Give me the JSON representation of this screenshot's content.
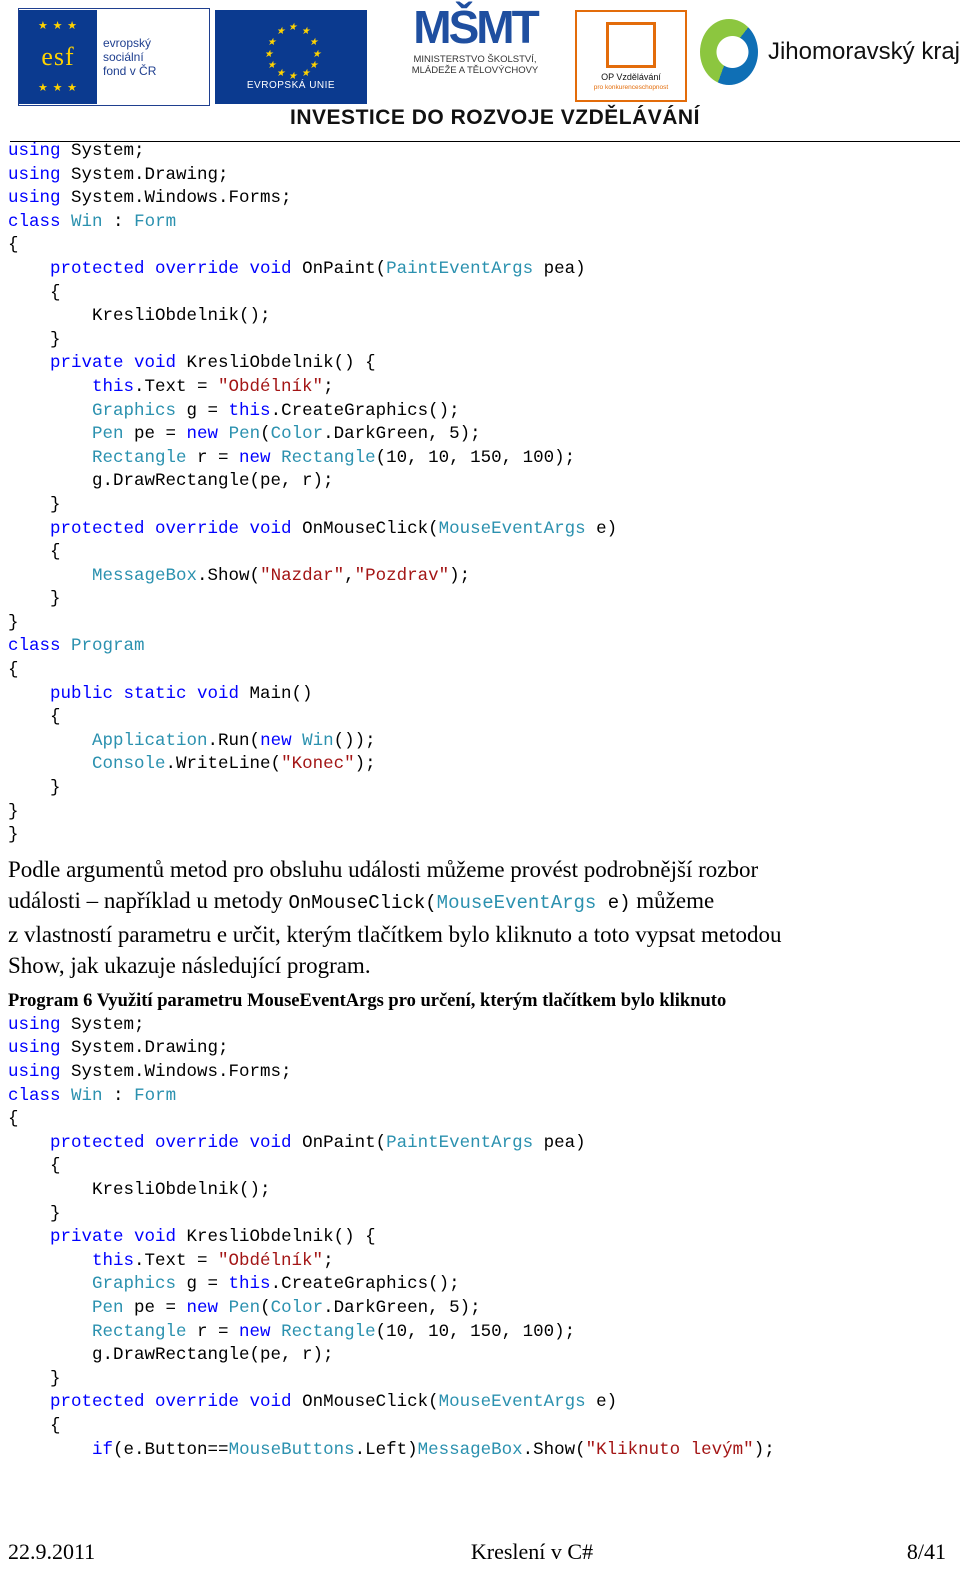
{
  "header": {
    "esf": {
      "line1": "evropský",
      "line2": "sociální",
      "line3": "fond v ČR",
      "brand": "esf",
      "stars": "★ ★ ★"
    },
    "eu": {
      "label": "EVROPSKÁ UNIE",
      "stars": "★"
    },
    "msmt": {
      "mark": "MŠMT",
      "sub_line1": "MINISTERSTVO ŠKOLSTVÍ,",
      "sub_line2": "MLÁDEŽE A TĚLOVÝCHOVY"
    },
    "opvk": {
      "line1": "OP Vzdělávání",
      "line2": "pro konkurenceschopnost"
    },
    "jmk": {
      "label": "Jihomoravský kraj"
    },
    "banner": "INVESTICE DO ROZVOJE VZDĚLÁVÁNÍ"
  },
  "code_block_1": [
    [
      {
        "t": "using",
        "c": "kw"
      },
      {
        "t": " System;",
        "c": "plain"
      }
    ],
    [
      {
        "t": "using",
        "c": "kw"
      },
      {
        "t": " System.Drawing;",
        "c": "plain"
      }
    ],
    [
      {
        "t": "using",
        "c": "kw"
      },
      {
        "t": " System.Windows.Forms;",
        "c": "plain"
      }
    ],
    [
      {
        "t": "class",
        "c": "kw"
      },
      {
        "t": " ",
        "c": "plain"
      },
      {
        "t": "Win",
        "c": "type"
      },
      {
        "t": " : ",
        "c": "plain"
      },
      {
        "t": "Form",
        "c": "type"
      }
    ],
    [
      {
        "t": "{",
        "c": "plain"
      }
    ],
    [
      {
        "t": "    ",
        "c": "plain"
      },
      {
        "t": "protected override void",
        "c": "kw"
      },
      {
        "t": " OnPaint(",
        "c": "plain"
      },
      {
        "t": "PaintEventArgs",
        "c": "type"
      },
      {
        "t": " pea)",
        "c": "plain"
      }
    ],
    [
      {
        "t": "    {",
        "c": "plain"
      }
    ],
    [
      {
        "t": "        KresliObdelnik();",
        "c": "plain"
      }
    ],
    [
      {
        "t": "    }",
        "c": "plain"
      }
    ],
    [
      {
        "t": "    ",
        "c": "plain"
      },
      {
        "t": "private void",
        "c": "kw"
      },
      {
        "t": " KresliObdelnik() {",
        "c": "plain"
      }
    ],
    [
      {
        "t": "        ",
        "c": "plain"
      },
      {
        "t": "this",
        "c": "kw"
      },
      {
        "t": ".Text = ",
        "c": "plain"
      },
      {
        "t": "\"Obdélník\"",
        "c": "str"
      },
      {
        "t": ";",
        "c": "plain"
      }
    ],
    [
      {
        "t": "        ",
        "c": "plain"
      },
      {
        "t": "Graphics",
        "c": "type"
      },
      {
        "t": " g = ",
        "c": "plain"
      },
      {
        "t": "this",
        "c": "kw"
      },
      {
        "t": ".CreateGraphics();",
        "c": "plain"
      }
    ],
    [
      {
        "t": "        ",
        "c": "plain"
      },
      {
        "t": "Pen",
        "c": "type"
      },
      {
        "t": " pe = ",
        "c": "plain"
      },
      {
        "t": "new",
        "c": "kw"
      },
      {
        "t": " ",
        "c": "plain"
      },
      {
        "t": "Pen",
        "c": "type"
      },
      {
        "t": "(",
        "c": "plain"
      },
      {
        "t": "Color",
        "c": "type"
      },
      {
        "t": ".DarkGreen, 5);",
        "c": "plain"
      }
    ],
    [
      {
        "t": "        ",
        "c": "plain"
      },
      {
        "t": "Rectangle",
        "c": "type"
      },
      {
        "t": " r = ",
        "c": "plain"
      },
      {
        "t": "new",
        "c": "kw"
      },
      {
        "t": " ",
        "c": "plain"
      },
      {
        "t": "Rectangle",
        "c": "type"
      },
      {
        "t": "(10, 10, 150, 100);",
        "c": "plain"
      }
    ],
    [
      {
        "t": "        g.DrawRectangle(pe, r);",
        "c": "plain"
      }
    ],
    [
      {
        "t": "    }",
        "c": "plain"
      }
    ],
    [
      {
        "t": "    ",
        "c": "plain"
      },
      {
        "t": "protected override void",
        "c": "kw"
      },
      {
        "t": " OnMouseClick(",
        "c": "plain"
      },
      {
        "t": "MouseEventArgs",
        "c": "type"
      },
      {
        "t": " e)",
        "c": "plain"
      }
    ],
    [
      {
        "t": "    {",
        "c": "plain"
      }
    ],
    [
      {
        "t": "        ",
        "c": "plain"
      },
      {
        "t": "MessageBox",
        "c": "type"
      },
      {
        "t": ".Show(",
        "c": "plain"
      },
      {
        "t": "\"Nazdar\"",
        "c": "str"
      },
      {
        "t": ",",
        "c": "plain"
      },
      {
        "t": "\"Pozdrav\"",
        "c": "str"
      },
      {
        "t": ");",
        "c": "plain"
      }
    ],
    [
      {
        "t": "    }",
        "c": "plain"
      }
    ],
    [
      {
        "t": "}",
        "c": "plain"
      }
    ],
    [
      {
        "t": "class",
        "c": "kw"
      },
      {
        "t": " ",
        "c": "plain"
      },
      {
        "t": "Program",
        "c": "type"
      }
    ],
    [
      {
        "t": "{",
        "c": "plain"
      }
    ],
    [
      {
        "t": "    ",
        "c": "plain"
      },
      {
        "t": "public static void",
        "c": "kw"
      },
      {
        "t": " Main()",
        "c": "plain"
      }
    ],
    [
      {
        "t": "    {",
        "c": "plain"
      }
    ],
    [
      {
        "t": "        ",
        "c": "plain"
      },
      {
        "t": "Application",
        "c": "type"
      },
      {
        "t": ".Run(",
        "c": "plain"
      },
      {
        "t": "new",
        "c": "kw"
      },
      {
        "t": " ",
        "c": "plain"
      },
      {
        "t": "Win",
        "c": "type"
      },
      {
        "t": "());",
        "c": "plain"
      }
    ],
    [
      {
        "t": "        ",
        "c": "plain"
      },
      {
        "t": "Console",
        "c": "type"
      },
      {
        "t": ".WriteLine(",
        "c": "plain"
      },
      {
        "t": "\"Konec\"",
        "c": "str"
      },
      {
        "t": ");",
        "c": "plain"
      }
    ],
    [
      {
        "t": "    }",
        "c": "plain"
      }
    ],
    [
      {
        "t": "}",
        "c": "plain"
      }
    ],
    [
      {
        "t": "}",
        "c": "plain"
      }
    ]
  ],
  "paragraph": {
    "line1_a": "Podle argumentů metod pro obsluhu události můžeme provést podrobnější rozbor",
    "line2_a": "události – například u metody ",
    "line2_mono_1": "OnMouseClick(",
    "line2_mono_type": "MouseEventArgs",
    "line2_mono_2": " e)",
    "line2_b": " můžeme",
    "line3": "z vlastností parametru e určit, kterým tlačítkem bylo kliknuto a toto vypsat metodou",
    "line4": "Show, jak ukazuje následující program."
  },
  "program_title": "Program  6 Využití parametru MouseEventArgs pro určení, kterým tlačítkem bylo kliknuto",
  "code_block_2": [
    [
      {
        "t": "using",
        "c": "kw"
      },
      {
        "t": " System;",
        "c": "plain"
      }
    ],
    [
      {
        "t": "using",
        "c": "kw"
      },
      {
        "t": " System.Drawing;",
        "c": "plain"
      }
    ],
    [
      {
        "t": "using",
        "c": "kw"
      },
      {
        "t": " System.Windows.Forms;",
        "c": "plain"
      }
    ],
    [
      {
        "t": "class",
        "c": "kw"
      },
      {
        "t": " ",
        "c": "plain"
      },
      {
        "t": "Win",
        "c": "type"
      },
      {
        "t": " : ",
        "c": "plain"
      },
      {
        "t": "Form",
        "c": "type"
      }
    ],
    [
      {
        "t": "{",
        "c": "plain"
      }
    ],
    [
      {
        "t": "    ",
        "c": "plain"
      },
      {
        "t": "protected override void",
        "c": "kw"
      },
      {
        "t": " OnPaint(",
        "c": "plain"
      },
      {
        "t": "PaintEventArgs",
        "c": "type"
      },
      {
        "t": " pea)",
        "c": "plain"
      }
    ],
    [
      {
        "t": "    {",
        "c": "plain"
      }
    ],
    [
      {
        "t": "        KresliObdelnik();",
        "c": "plain"
      }
    ],
    [
      {
        "t": "    }",
        "c": "plain"
      }
    ],
    [
      {
        "t": "    ",
        "c": "plain"
      },
      {
        "t": "private void",
        "c": "kw"
      },
      {
        "t": " KresliObdelnik() {",
        "c": "plain"
      }
    ],
    [
      {
        "t": "        ",
        "c": "plain"
      },
      {
        "t": "this",
        "c": "kw"
      },
      {
        "t": ".Text = ",
        "c": "plain"
      },
      {
        "t": "\"Obdélník\"",
        "c": "str"
      },
      {
        "t": ";",
        "c": "plain"
      }
    ],
    [
      {
        "t": "        ",
        "c": "plain"
      },
      {
        "t": "Graphics",
        "c": "type"
      },
      {
        "t": " g = ",
        "c": "plain"
      },
      {
        "t": "this",
        "c": "kw"
      },
      {
        "t": ".CreateGraphics();",
        "c": "plain"
      }
    ],
    [
      {
        "t": "        ",
        "c": "plain"
      },
      {
        "t": "Pen",
        "c": "type"
      },
      {
        "t": " pe = ",
        "c": "plain"
      },
      {
        "t": "new",
        "c": "kw"
      },
      {
        "t": " ",
        "c": "plain"
      },
      {
        "t": "Pen",
        "c": "type"
      },
      {
        "t": "(",
        "c": "plain"
      },
      {
        "t": "Color",
        "c": "type"
      },
      {
        "t": ".DarkGreen, 5);",
        "c": "plain"
      }
    ],
    [
      {
        "t": "        ",
        "c": "plain"
      },
      {
        "t": "Rectangle",
        "c": "type"
      },
      {
        "t": " r = ",
        "c": "plain"
      },
      {
        "t": "new",
        "c": "kw"
      },
      {
        "t": " ",
        "c": "plain"
      },
      {
        "t": "Rectangle",
        "c": "type"
      },
      {
        "t": "(10, 10, 150, 100);",
        "c": "plain"
      }
    ],
    [
      {
        "t": "        g.DrawRectangle(pe, r);",
        "c": "plain"
      }
    ],
    [
      {
        "t": "    }",
        "c": "plain"
      }
    ],
    [
      {
        "t": "    ",
        "c": "plain"
      },
      {
        "t": "protected override void",
        "c": "kw"
      },
      {
        "t": " OnMouseClick(",
        "c": "plain"
      },
      {
        "t": "MouseEventArgs",
        "c": "type"
      },
      {
        "t": " e)",
        "c": "plain"
      }
    ],
    [
      {
        "t": "    {",
        "c": "plain"
      }
    ],
    [
      {
        "t": "        ",
        "c": "plain"
      },
      {
        "t": "if",
        "c": "kw"
      },
      {
        "t": "(e.Button==",
        "c": "plain"
      },
      {
        "t": "MouseButtons",
        "c": "type"
      },
      {
        "t": ".Left)",
        "c": "plain"
      },
      {
        "t": "MessageBox",
        "c": "type"
      },
      {
        "t": ".Show(",
        "c": "plain"
      },
      {
        "t": "\"Kliknuto levým\"",
        "c": "str"
      },
      {
        "t": ");",
        "c": "plain"
      }
    ]
  ],
  "footer": {
    "date": "22.9.2011",
    "center": "Kreslení v C#",
    "page": "8/41"
  }
}
